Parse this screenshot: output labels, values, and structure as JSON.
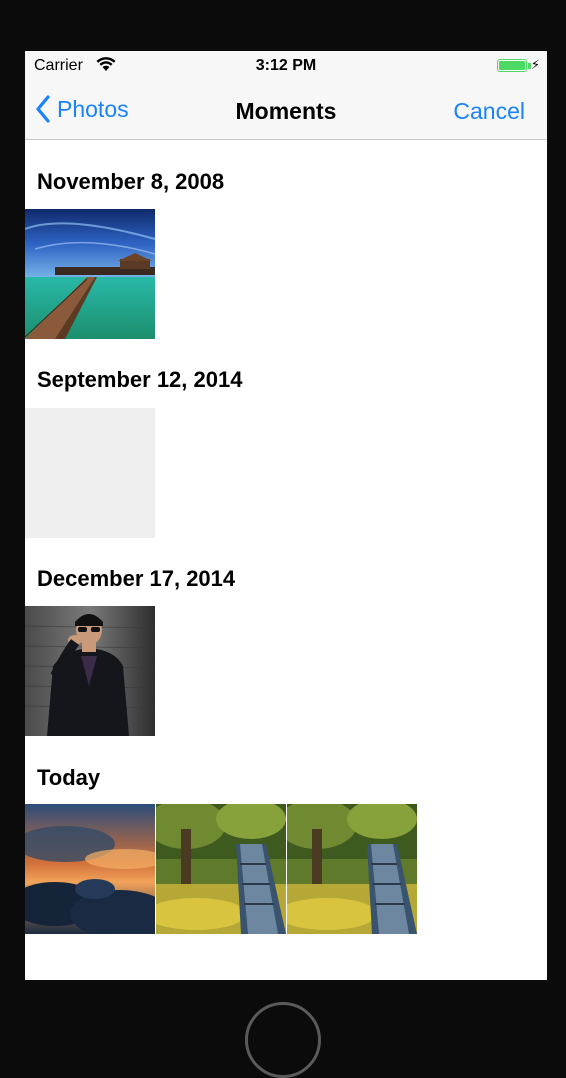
{
  "status_bar": {
    "carrier": "Carrier",
    "time": "3:12 PM",
    "wifi_icon": "wifi-icon",
    "battery_icon": "battery-icon",
    "battery_level": 1.0,
    "battery_color": "#4cd964"
  },
  "nav": {
    "back_label": "Photos",
    "back_icon": "chevron-left-icon",
    "title": "Moments",
    "cancel_label": "Cancel",
    "accent_color": "#1a82fb"
  },
  "moments": [
    {
      "date": "November 8, 2008",
      "photos": [
        "pier-over-turquoise-water"
      ]
    },
    {
      "date": "September 12, 2014",
      "photos": [
        "blank-placeholder"
      ]
    },
    {
      "date": "December 17, 2014",
      "photos": [
        "man-in-suit-with-sunglasses"
      ]
    },
    {
      "date": "Today",
      "photos": [
        "sunset-clouds",
        "forest-road-film",
        "forest-road-film"
      ]
    }
  ]
}
